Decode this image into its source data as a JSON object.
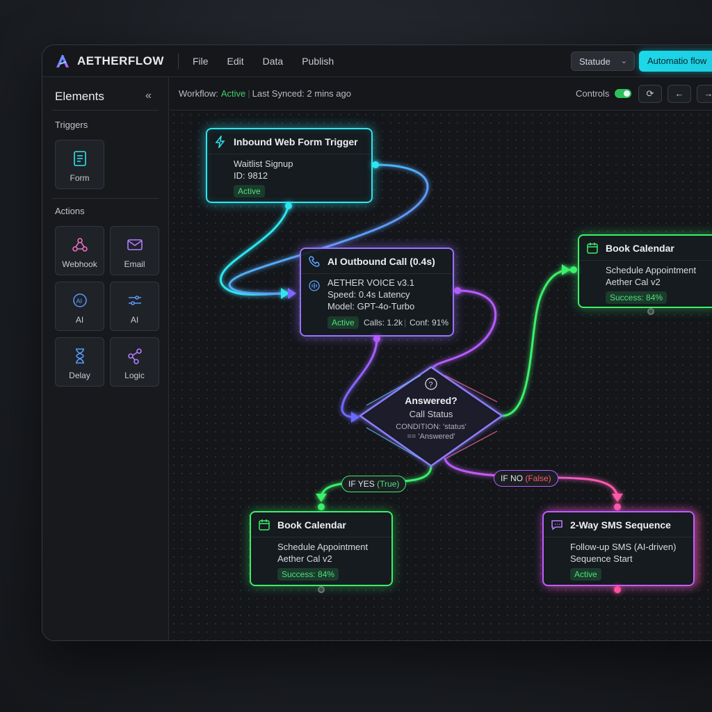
{
  "app": {
    "name": "AETHERFLOW"
  },
  "menu": [
    "File",
    "Edit",
    "Data",
    "Publish"
  ],
  "topbar": {
    "status_select": "Statude",
    "automation_button": "Automatio flow"
  },
  "sidebar": {
    "title": "Elements",
    "triggers_label": "Triggers",
    "actions_label": "Actions",
    "triggers": [
      {
        "label": "Form",
        "icon": "form-icon"
      }
    ],
    "actions": [
      {
        "label": "Webhook",
        "icon": "webhook-icon"
      },
      {
        "label": "Email",
        "icon": "email-icon"
      },
      {
        "label": "AI",
        "icon": "ai-chip-icon"
      },
      {
        "label": "AI",
        "icon": "sliders-icon"
      },
      {
        "label": "Delay",
        "icon": "hourglass-icon"
      },
      {
        "label": "Logic",
        "icon": "logic-branch-icon"
      }
    ]
  },
  "subbar": {
    "workflow_label": "Workflow:",
    "workflow_status": "Active",
    "last_synced": "Last Synced: 2 mins ago",
    "controls_label": "Controls",
    "controls_enabled": true
  },
  "nodes": {
    "trigger": {
      "title": "Inbound Web Form Trigger",
      "line1": "Waitlist Signup",
      "line2": "ID: 9812",
      "badge": "Active"
    },
    "call": {
      "title": "AI Outbound Call (0.4s)",
      "line1": "AETHER VOICE v3.1",
      "line2": "Speed: 0.4s Latency",
      "line3": "Model: GPT-4o-Turbo",
      "badge": "Active",
      "calls": "Calls: 1.2k",
      "conf": "Conf: 91%"
    },
    "book_right": {
      "title": "Book Calendar",
      "line1": "Schedule Appointment",
      "line2": "Aether Cal v2",
      "badge": "Success: 84%"
    },
    "condition": {
      "title": "Answered?",
      "subtitle": "Call Status",
      "condition1": "CONDITION: 'status'",
      "condition2": "== 'Answered'"
    },
    "book_bottom": {
      "title": "Book Calendar",
      "line1": "Schedule Appointment",
      "line2": "Aether Cal v2",
      "badge": "Success: 84%"
    },
    "sms": {
      "title": "2-Way SMS Sequence",
      "line1": "Follow-up SMS (AI-driven)",
      "line2": "Sequence Start",
      "badge": "Active"
    }
  },
  "edges": {
    "yes": {
      "prefix": "IF YES",
      "value": "(True)"
    },
    "no": {
      "prefix": "IF NO",
      "value": "(False)"
    }
  },
  "colors": {
    "cyan": "#2ee6f0",
    "blue": "#5a7dff",
    "purple": "#b55cff",
    "green": "#3cf06a",
    "pink": "#ff4f8a",
    "active_green": "#3fd06a"
  }
}
